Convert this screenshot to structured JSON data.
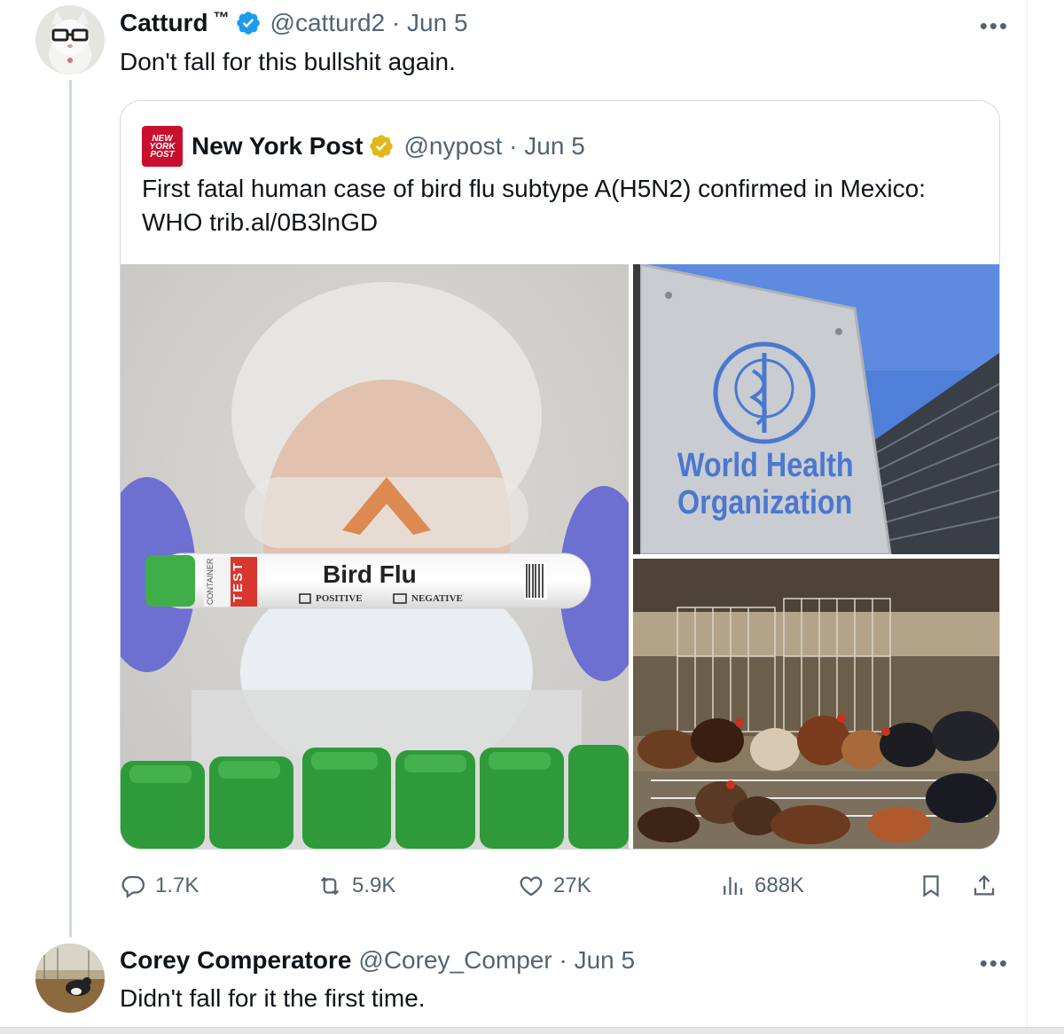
{
  "tweet": {
    "author_name": "Catturd",
    "author_suffix": "™",
    "handle": "@catturd2",
    "date": "Jun 5",
    "text": "Don't fall for this bullshit again.",
    "more": "•••"
  },
  "quote": {
    "logo_text": [
      "NEW",
      "YORK",
      "POST"
    ],
    "author_name": "New York Post",
    "handle": "@nypost",
    "date": "Jun 5",
    "text_line1": "First fatal human case of bird flu subtype A(H5N2) confirmed in Mexico:",
    "text_line2": "WHO trib.al/0B3lnGD",
    "media": {
      "tube_test": "TEST",
      "tube_container": "CONTAINER",
      "tube_title": "Bird Flu",
      "tube_positive": "POSITIVE",
      "tube_negative": "NEGATIVE",
      "sign_line1": "World Health",
      "sign_line2": "Organization"
    }
  },
  "actions": {
    "replies": "1.7K",
    "reposts": "5.9K",
    "likes": "27K",
    "views": "688K"
  },
  "reply": {
    "author_name": "Corey Comperatore",
    "handle": "@Corey_Comper",
    "date": "Jun 5",
    "text": "Didn't fall for it the first time.",
    "more": "•••"
  },
  "colors": {
    "verified_blue": "#1d9bf0",
    "verified_gold": "#e2b719",
    "nypost_red": "#c8102e",
    "muted_text": "#536471"
  }
}
